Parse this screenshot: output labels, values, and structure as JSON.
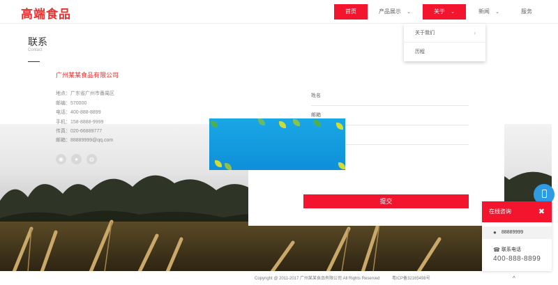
{
  "header": {
    "logo": "高端食品",
    "nav": [
      {
        "label": "首页",
        "active": true
      },
      {
        "label": "产品展示",
        "chevron": "⌄"
      },
      {
        "label": "关于",
        "active": true,
        "chevron": "⌄"
      },
      {
        "label": "新闻",
        "chevron": "⌄"
      },
      {
        "label": "服务"
      }
    ]
  },
  "dropdown": {
    "items": [
      "关于我们",
      "历程"
    ],
    "arrow": "›"
  },
  "section": {
    "title": "联系",
    "subtitle": "Contact"
  },
  "company": {
    "name": "广州某某食品有限公司",
    "lines": [
      "地点：广东省广州市番禺区",
      "邮编：570000",
      "电话：400-888-8899",
      "手机：158-8888-9999",
      "传真：020-66889777",
      "邮箱：88889999@qq.com"
    ],
    "social_icons": [
      "weibo-icon",
      "qq-icon",
      "wechat-icon"
    ]
  },
  "form": {
    "fields": [
      "姓名",
      "邮箱"
    ],
    "submit_label": "提交"
  },
  "chat": {
    "title": "在线咨询",
    "close": "✖",
    "qq": "88889999",
    "phone_label": "联系电话",
    "phone": "400-888-8899"
  },
  "footer": {
    "copyright": "Copyright @ 2011-2017 广州某某食品有限公司 All Rights Reserved",
    "icp": "粤ICP备32165498号",
    "up_icon": "^"
  },
  "colors": {
    "accent": "#f3142e",
    "brand": "#e8312f",
    "chat_blue": "#2f9be3"
  }
}
